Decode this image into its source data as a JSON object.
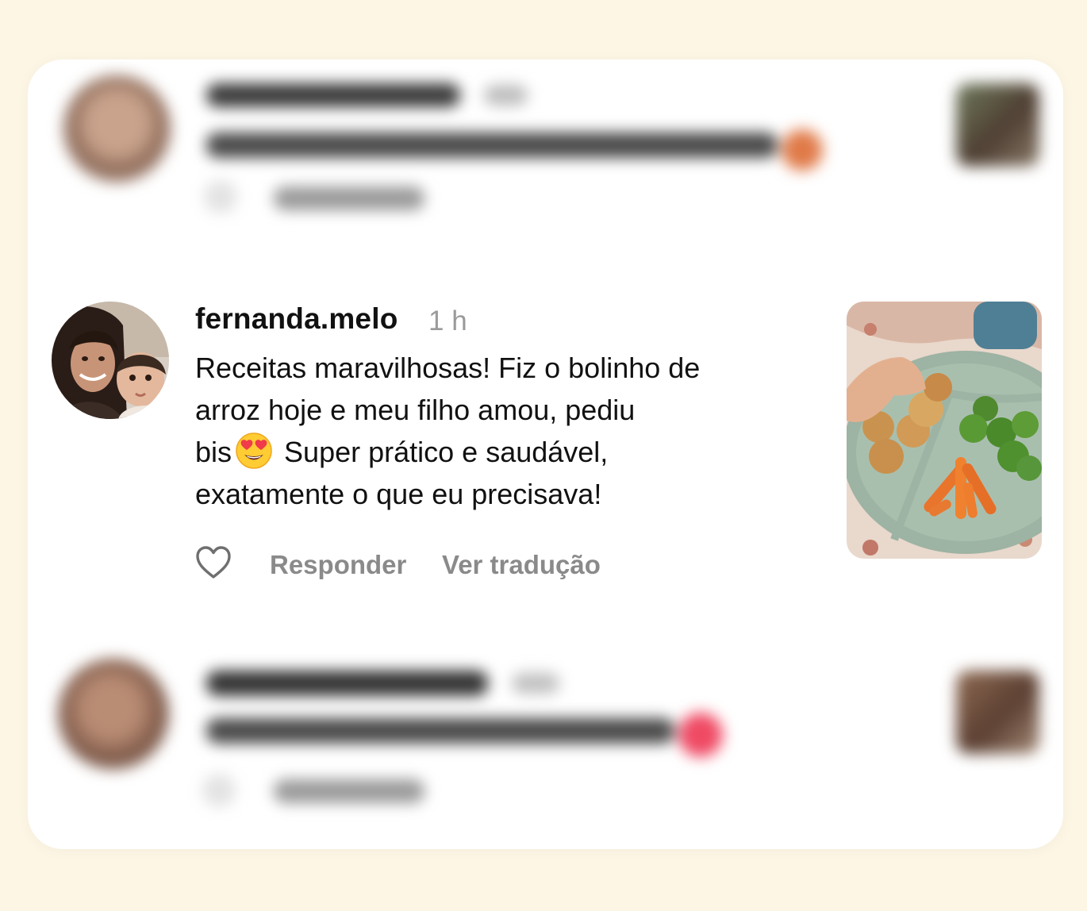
{
  "comment": {
    "username": "fernanda.melo",
    "time": "1 h",
    "lines": [
      "Receitas maravilhosas! Fiz o bolinho de",
      "arroz hoje e meu filho amou, pediu",
      "Super prático e saudável,",
      "exatamente o que eu precisava!"
    ],
    "line3_prefix": "bis",
    "emoji": "heart-eyes-emoji",
    "actions": {
      "reply": "Responder",
      "translate": "Ver tradução"
    }
  },
  "icons": {
    "like": "heart-outline-icon"
  },
  "colors": {
    "page_background": "#fdf6e5",
    "card_background": "#ffffff",
    "action_text": "#8a8a8a",
    "time_text": "#9a9a9a"
  }
}
